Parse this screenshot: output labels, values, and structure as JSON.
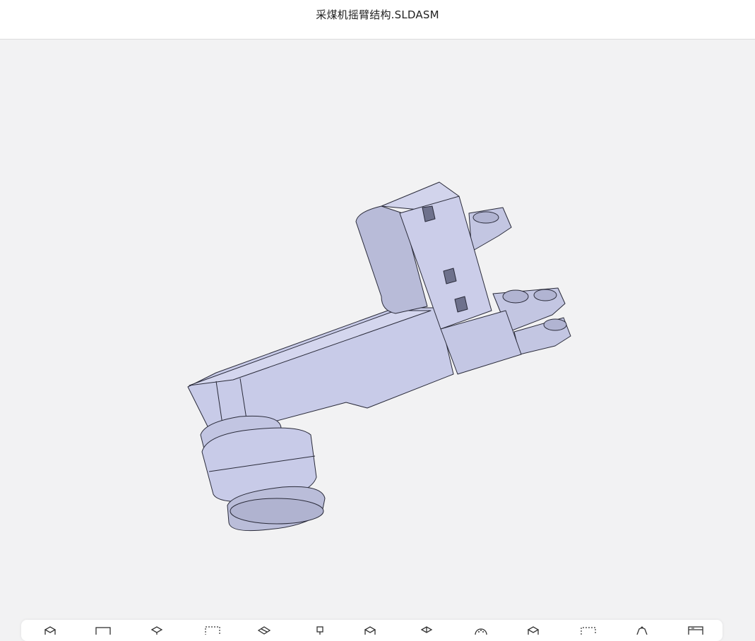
{
  "window": {
    "title": "采煤机摇臂结构.SLDASM"
  },
  "viewport": {
    "background_color": "#f2f2f3",
    "model_fill_color": "#c6c9e6",
    "model_edge_color": "#2a2b3a"
  },
  "toolbar": {
    "tools": [
      {
        "icon": "view-cube-icon"
      },
      {
        "icon": "front-view-icon"
      },
      {
        "icon": "isometric-view-icon"
      },
      {
        "icon": "zoom-window-icon"
      },
      {
        "icon": "section-view-icon"
      },
      {
        "icon": "explode-icon"
      },
      {
        "icon": "display-style-icon"
      },
      {
        "icon": "hide-show-icon"
      },
      {
        "icon": "appearance-icon"
      },
      {
        "icon": "rotate-icon"
      },
      {
        "icon": "select-box-icon"
      },
      {
        "icon": "measure-icon"
      },
      {
        "icon": "window-settings-icon"
      }
    ]
  }
}
